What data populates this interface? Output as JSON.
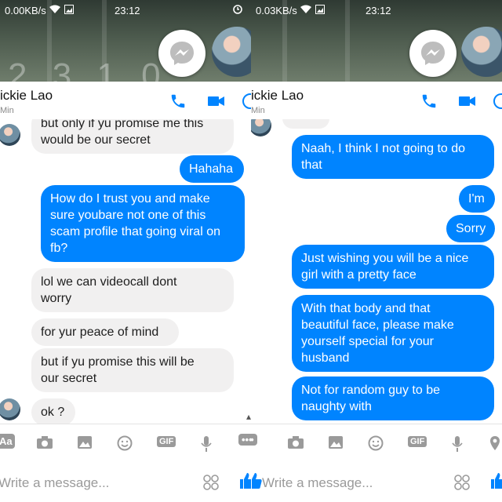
{
  "left": {
    "status": {
      "speed": "0.00KB/s",
      "time": "23:12"
    },
    "header": {
      "name": "ickie Lao",
      "sub": "Min"
    },
    "messages": [
      "but only if yu promise me this\nwould be our secret",
      "Hahaha",
      "How do I trust you and make\nsure youbare not one of this\nscam profile that going viral on\nfb?",
      "lol we can videocall dont\nworry",
      "for yur peace of mind",
      "but if yu promise this will be\nour secret",
      "ok ?"
    ],
    "toolbar": {
      "aa": "Aa",
      "gif": "GIF"
    },
    "input_placeholder": "Write a message..."
  },
  "right": {
    "status": {
      "speed": "0.03KB/s",
      "time": "23:12"
    },
    "header": {
      "name": "ickie Lao",
      "sub": "Min"
    },
    "messages": [
      "Naah, I think I not going to do\nthat",
      "I'm",
      "Sorry",
      "Just wishing you will be a nice\ngirl with a pretty face",
      "With that body and that\nbeautiful face, please make\nyourself special for your\nhusband",
      "Not for random guy to be\nnaughty with"
    ],
    "toolbar": {
      "gif": "GIF"
    },
    "input_placeholder": "Write a message..."
  },
  "colors": {
    "outgoing": "#0084ff",
    "incoming": "#f1f0f0",
    "accent": "#0084ff"
  }
}
